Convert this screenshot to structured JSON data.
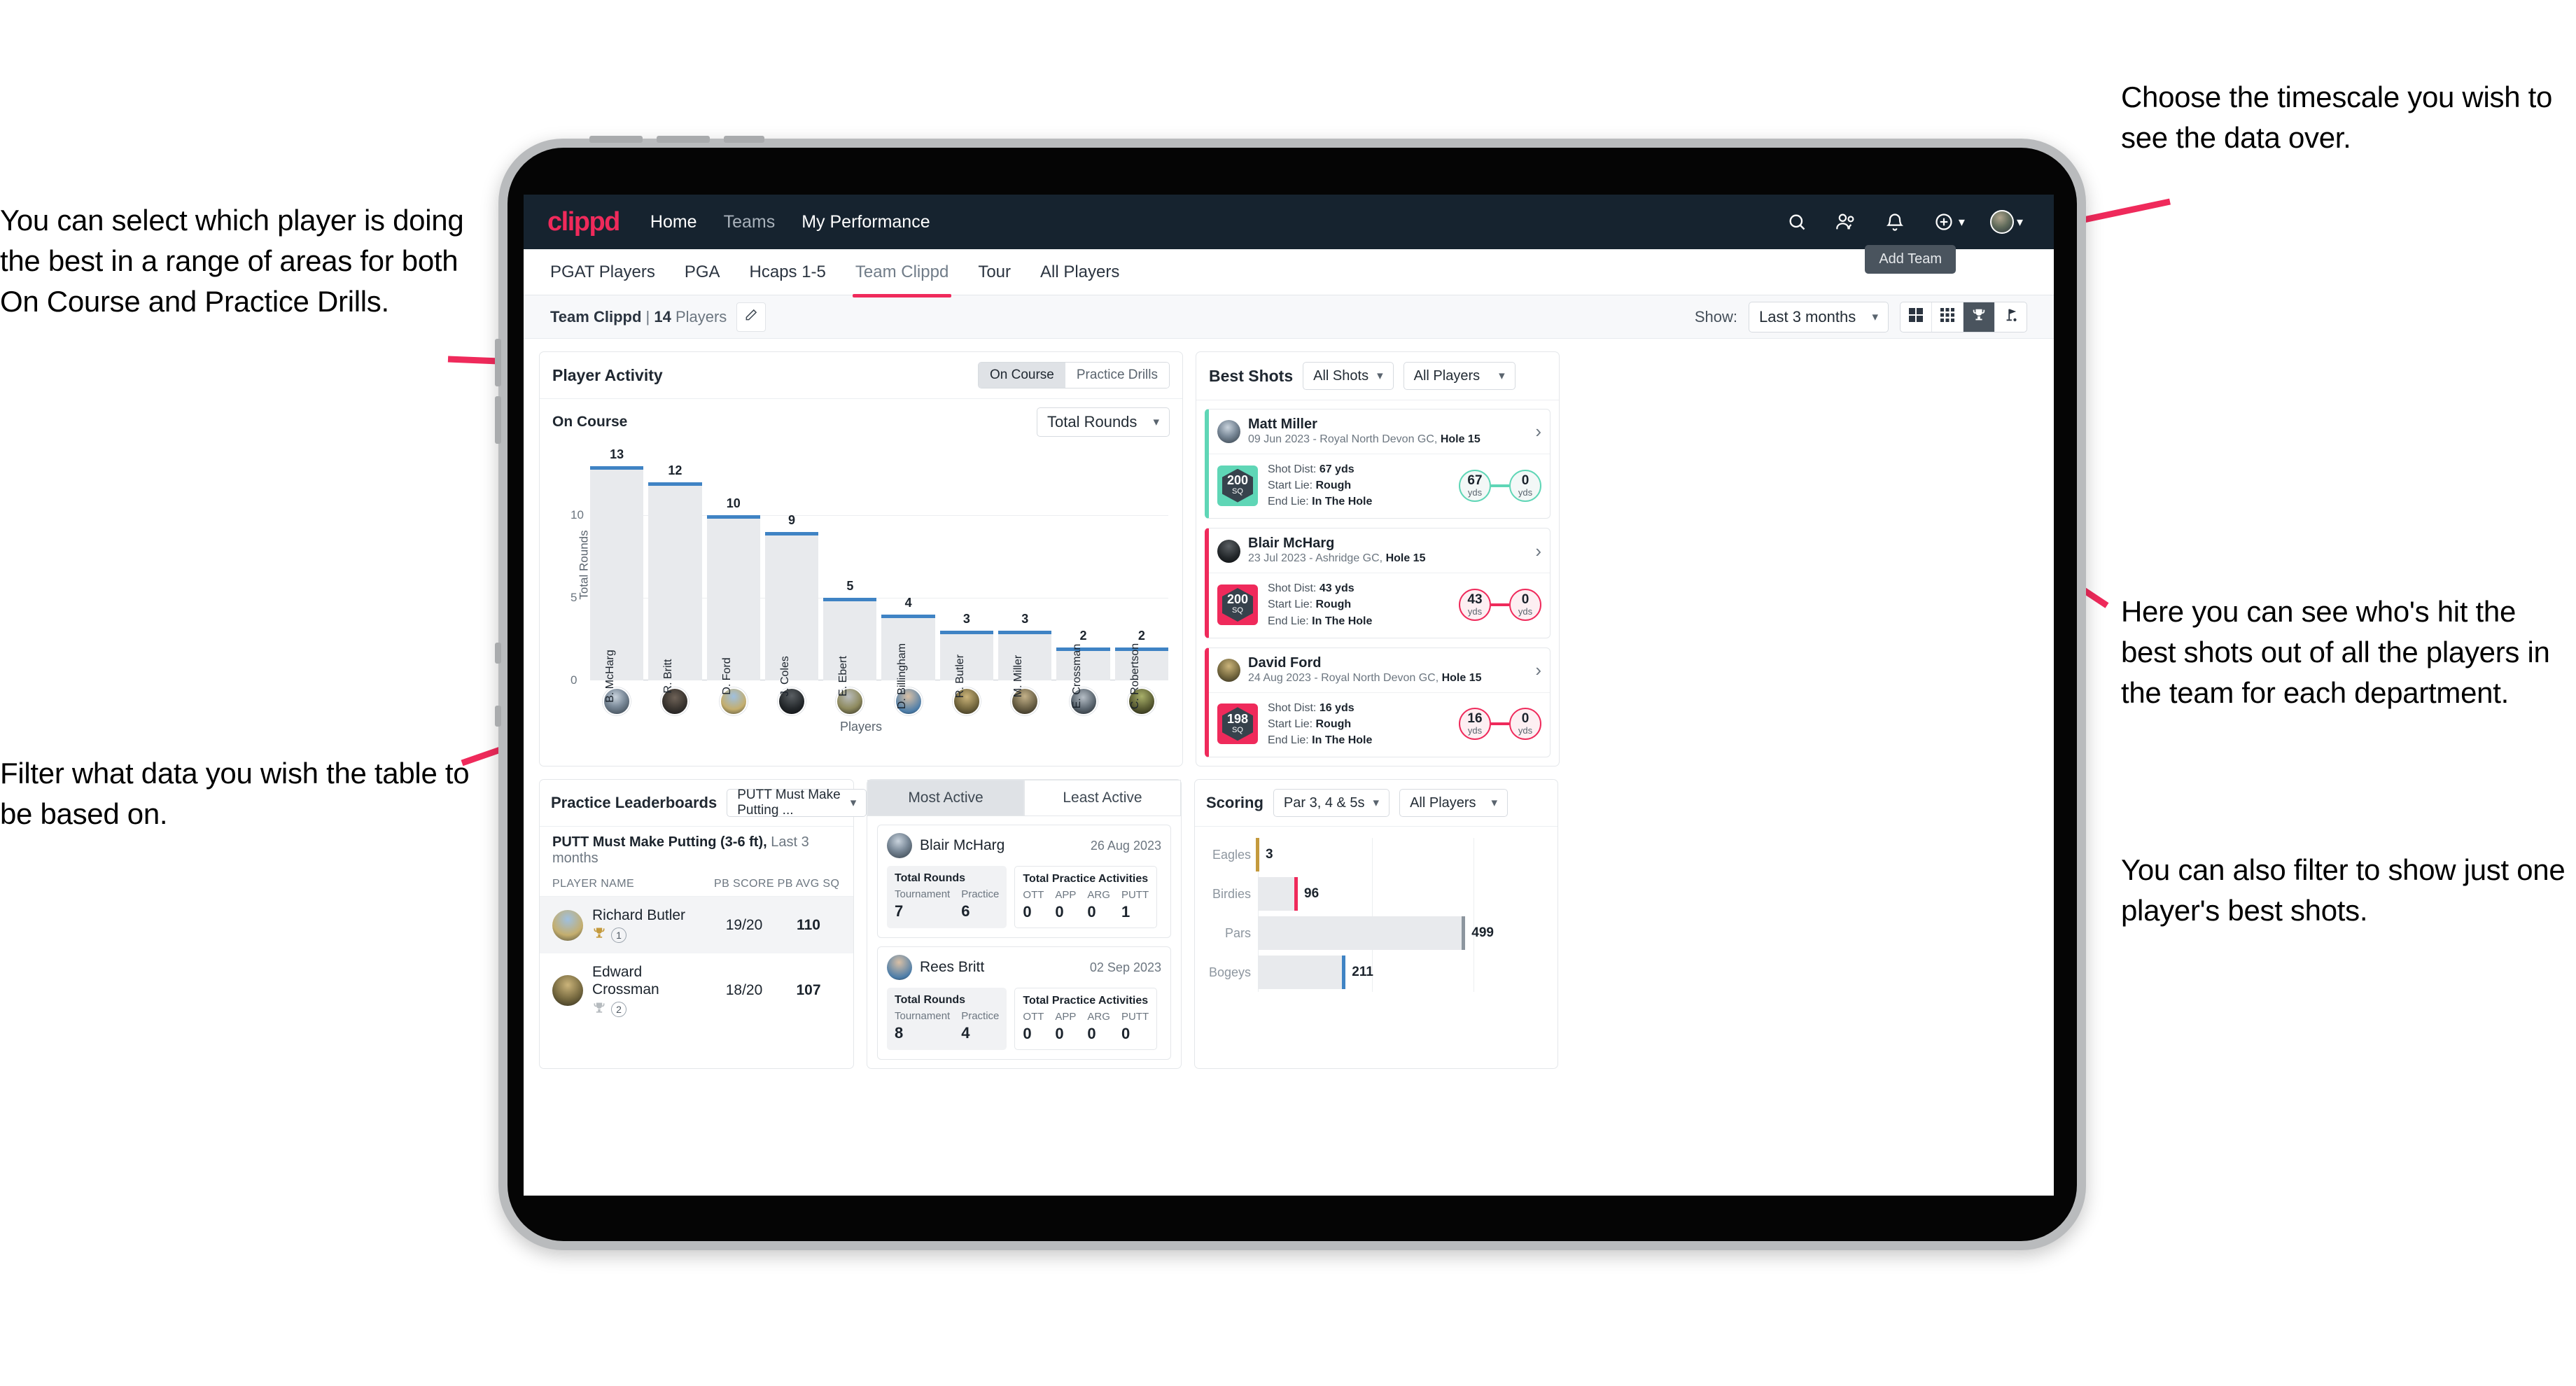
{
  "annotations": {
    "left_top": "You can select which player is doing the best in a range of areas for both On Course and Practice Drills.",
    "left_bottom": "Filter what data you wish the table to be based on.",
    "right_top": "Choose the timescale you wish to see the data over.",
    "right_middle": "Here you can see who's hit the best shots out of all the players in the team for each department.",
    "right_bottom": "You can also filter to show just one player's best shots."
  },
  "navbar": {
    "logo": "clippd",
    "links": [
      {
        "label": "Home",
        "dim": false
      },
      {
        "label": "Teams",
        "dim": true
      },
      {
        "label": "My Performance",
        "dim": false
      }
    ],
    "icons": [
      "search-icon",
      "people-icon",
      "bell-icon",
      "plus-circle-icon",
      "profile-avatar"
    ]
  },
  "tabs": {
    "items": [
      {
        "label": "PGAT Players",
        "active": false
      },
      {
        "label": "PGA",
        "active": false
      },
      {
        "label": "Hcaps 1-5",
        "active": false
      },
      {
        "label": "Team Clippd",
        "active": true
      },
      {
        "label": "Tour",
        "active": false
      },
      {
        "label": "All Players",
        "active": false
      }
    ],
    "tooltip": "Add Team"
  },
  "toolbar": {
    "team_name": "Team Clippd",
    "separator": " | ",
    "player_count": "14",
    "players_word": "Players",
    "edit_icon": "pencil-icon",
    "show_label": "Show:",
    "timescale_value": "Last 3 months",
    "views": [
      {
        "icon": "grid-4-icon",
        "active": false
      },
      {
        "icon": "grid-9-icon",
        "active": false
      },
      {
        "icon": "trophy-icon",
        "active": true
      },
      {
        "icon": "golf-flag-icon",
        "active": false
      }
    ]
  },
  "player_activity": {
    "title": "Player Activity",
    "segments": [
      {
        "label": "On Course",
        "active": true
      },
      {
        "label": "Practice Drills",
        "active": false
      }
    ],
    "sub_label": "On Course",
    "metric_value": "Total Rounds"
  },
  "chart_data": [
    {
      "type": "bar",
      "title": "Player Activity",
      "xlabel": "Players",
      "ylabel": "Total Rounds",
      "categories": [
        "B. McHarg",
        "R. Britt",
        "D. Ford",
        "J. Coles",
        "E. Ebert",
        "D. Billingham",
        "R. Butler",
        "M. Miller",
        "E. Crossman",
        "C. Robertson"
      ],
      "values": [
        13,
        12,
        10,
        9,
        5,
        4,
        3,
        3,
        2,
        2
      ],
      "yticks": [
        0,
        5,
        10
      ],
      "ylim": [
        0,
        14
      ],
      "grid": true,
      "bar_color": "#e8eaed",
      "cap_color": "#3f83c4"
    },
    {
      "type": "bar",
      "orientation": "horizontal",
      "title": "Scoring",
      "categories": [
        "Eagles",
        "Birdies",
        "Pars",
        "Bogeys"
      ],
      "values": [
        3,
        96,
        499,
        211
      ],
      "cap_colors": [
        "#c49a3d",
        "#ef2a5b",
        "#8d969f",
        "#3f83c4"
      ],
      "bar_color": "#e8eaed",
      "xlim": [
        0,
        640
      ],
      "grid": true
    }
  ],
  "best_shots": {
    "title": "Best Shots",
    "filter_shots": "All Shots",
    "filter_players": "All Players",
    "shots": [
      {
        "player": "Matt Miller",
        "meta_date": "09 Jun 2023 - Royal North Devon GC, ",
        "meta_hole": "Hole 15",
        "badge_number": "200",
        "badge_unit": "SQ",
        "accent": "#5fd6b6",
        "shot_dist_label": "Shot Dist: ",
        "shot_dist_value": "67 yds",
        "start_lie_label": "Start Lie: ",
        "start_lie_value": "Rough",
        "end_lie_label": "End Lie: ",
        "end_lie_value": "In The Hole",
        "from_value": "67",
        "from_unit": "yds",
        "to_value": "0",
        "to_unit": "yds"
      },
      {
        "player": "Blair McHarg",
        "meta_date": "23 Jul 2023 - Ashridge GC, ",
        "meta_hole": "Hole 15",
        "badge_number": "200",
        "badge_unit": "SQ",
        "accent": "#ef2a5b",
        "shot_dist_label": "Shot Dist: ",
        "shot_dist_value": "43 yds",
        "start_lie_label": "Start Lie: ",
        "start_lie_value": "Rough",
        "end_lie_label": "End Lie: ",
        "end_lie_value": "In The Hole",
        "from_value": "43",
        "from_unit": "yds",
        "to_value": "0",
        "to_unit": "yds"
      },
      {
        "player": "David Ford",
        "meta_date": "24 Aug 2023 - Royal North Devon GC, ",
        "meta_hole": "Hole 15",
        "badge_number": "198",
        "badge_unit": "SQ",
        "accent": "#ef2a5b",
        "shot_dist_label": "Shot Dist: ",
        "shot_dist_value": "16 yds",
        "start_lie_label": "Start Lie: ",
        "start_lie_value": "Rough",
        "end_lie_label": "End Lie: ",
        "end_lie_value": "In The Hole",
        "from_value": "16",
        "from_unit": "yds",
        "to_value": "0",
        "to_unit": "yds"
      }
    ]
  },
  "practice_leaderboards": {
    "title": "Practice Leaderboards",
    "drill_value": "PUTT Must Make Putting ...",
    "subtitle_bold": "PUTT Must Make Putting (3-6 ft),",
    "subtitle_muted": " Last 3 months",
    "columns": [
      "PLAYER NAME",
      "PB SCORE",
      "PB AVG SQ"
    ],
    "rows": [
      {
        "name": "Richard Butler",
        "rank": "1",
        "trophy": "gold",
        "score": "19/20",
        "avg_sq": "110"
      },
      {
        "name": "Edward Crossman",
        "rank": "2",
        "trophy": "silver",
        "score": "18/20",
        "avg_sq": "107"
      }
    ]
  },
  "activity": {
    "tabs": [
      {
        "label": "Most Active",
        "active": true
      },
      {
        "label": "Least Active",
        "active": false
      }
    ],
    "cards": [
      {
        "player": "Blair McHarg",
        "date": "26 Aug 2023",
        "rounds_title": "Total Rounds",
        "rounds": [
          {
            "key": "Tournament",
            "value": "7"
          },
          {
            "key": "Practice",
            "value": "6"
          }
        ],
        "practice_title": "Total Practice Activities",
        "practice": [
          {
            "key": "OTT",
            "value": "0"
          },
          {
            "key": "APP",
            "value": "0"
          },
          {
            "key": "ARG",
            "value": "0"
          },
          {
            "key": "PUTT",
            "value": "1"
          }
        ]
      },
      {
        "player": "Rees Britt",
        "date": "02 Sep 2023",
        "rounds_title": "Total Rounds",
        "rounds": [
          {
            "key": "Tournament",
            "value": "8"
          },
          {
            "key": "Practice",
            "value": "4"
          }
        ],
        "practice_title": "Total Practice Activities",
        "practice": [
          {
            "key": "OTT",
            "value": "0"
          },
          {
            "key": "APP",
            "value": "0"
          },
          {
            "key": "ARG",
            "value": "0"
          },
          {
            "key": "PUTT",
            "value": "0"
          }
        ]
      }
    ]
  },
  "scoring": {
    "title": "Scoring",
    "filter_par": "Par 3, 4 & 5s",
    "filter_players": "All Players"
  }
}
